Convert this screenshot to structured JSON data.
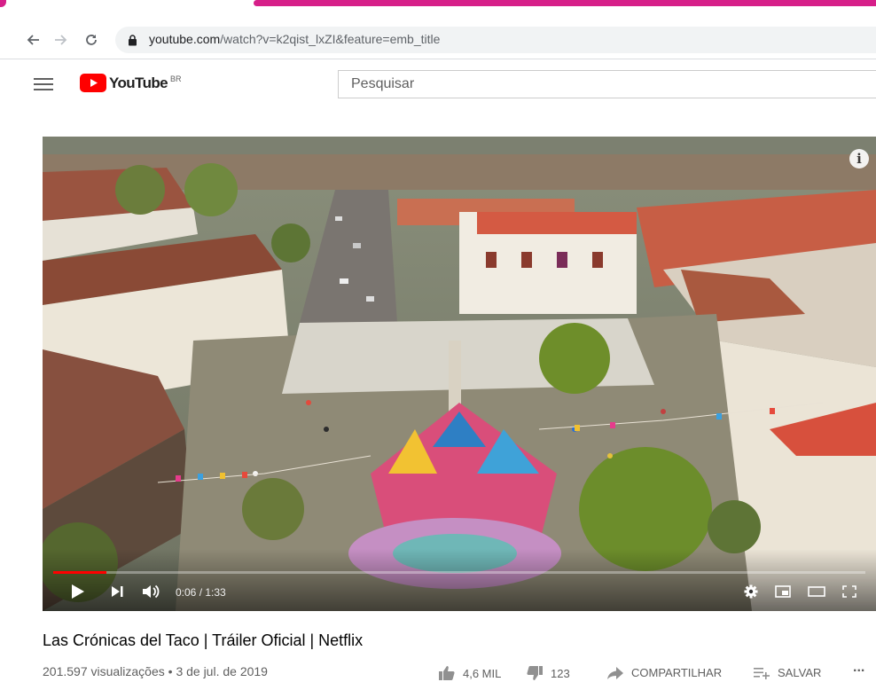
{
  "browser": {
    "url_host": "youtube.com",
    "url_path": "/watch?v=k2qist_lxZI&feature=emb_title",
    "load_progress": 0.71
  },
  "header": {
    "logo_text": "YouTube",
    "country_code": "BR",
    "search_placeholder": "Pesquisar"
  },
  "player": {
    "current_time": "0:06",
    "duration": "1:33",
    "time_text": "0:06 / 1:33",
    "played_fraction": 0.065
  },
  "video": {
    "title": "Las Crónicas del Taco | Tráiler Oficial | Netflix",
    "meta": "201.597 visualizações • 3 de jul. de 2019",
    "likes": "4,6 MIL",
    "dislikes": "123",
    "share_label": "COMPARTILHAR",
    "save_label": "SALVAR",
    "more_label": "..."
  },
  "colors": {
    "accent_pink": "#d61f89",
    "youtube_red": "#ff0000",
    "progress_red": "#ff0000"
  }
}
